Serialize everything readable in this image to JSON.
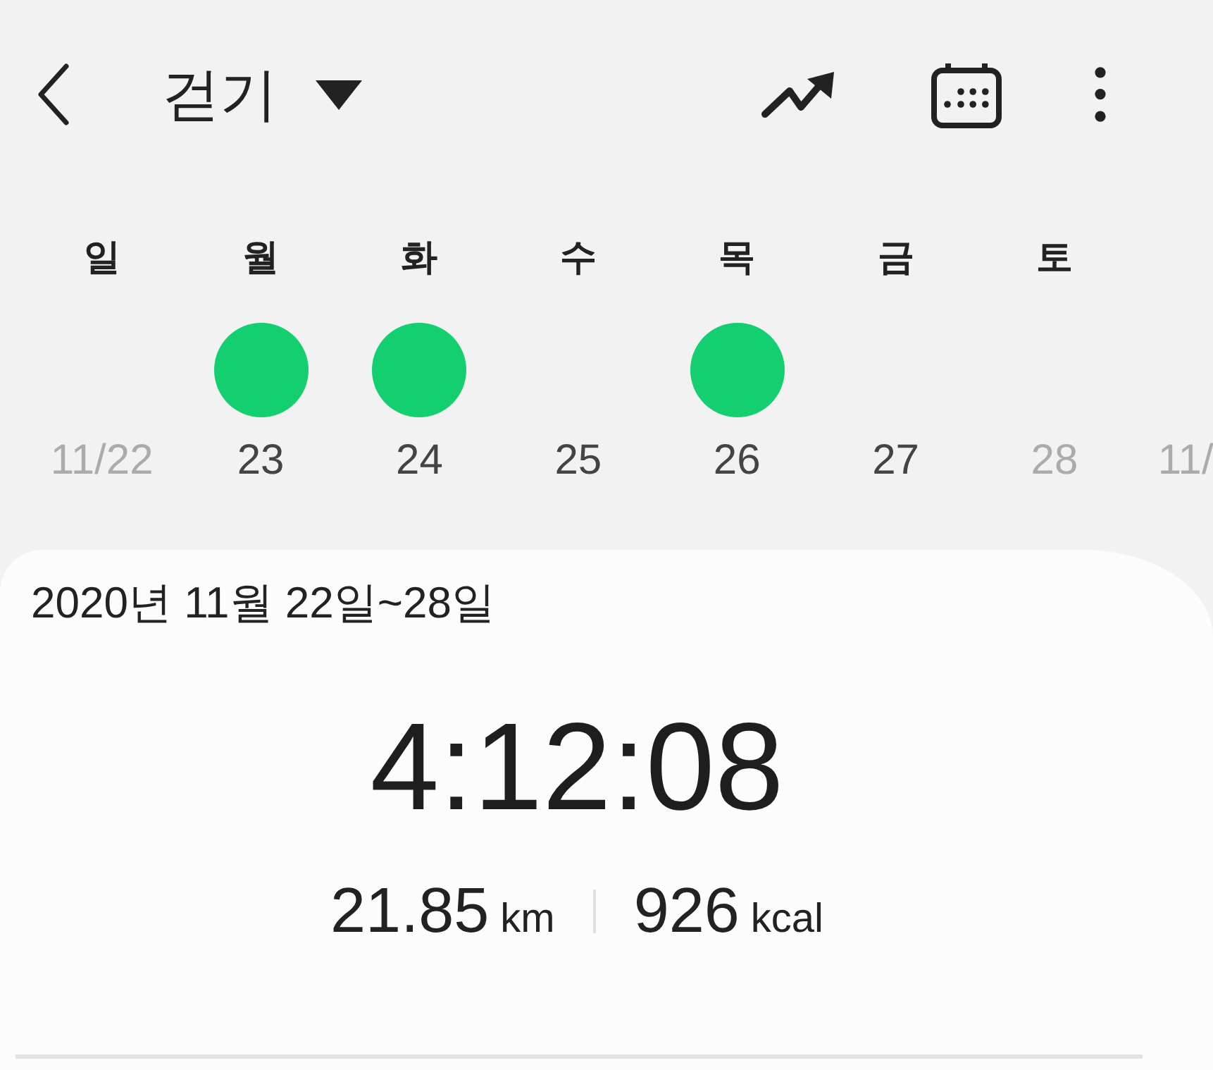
{
  "header": {
    "title": "걷기"
  },
  "week": {
    "weekdays": [
      "일",
      "월",
      "화",
      "수",
      "목",
      "금",
      "토"
    ],
    "days": [
      {
        "date": "11/22",
        "done": false,
        "dimmed": true,
        "cut": false
      },
      {
        "date": "23",
        "done": true,
        "dimmed": false,
        "cut": false
      },
      {
        "date": "24",
        "done": true,
        "dimmed": false,
        "cut": false
      },
      {
        "date": "25",
        "done": false,
        "dimmed": false,
        "cut": false
      },
      {
        "date": "26",
        "done": true,
        "dimmed": false,
        "cut": false
      },
      {
        "date": "27",
        "done": false,
        "dimmed": false,
        "cut": false
      },
      {
        "date": "28",
        "done": false,
        "dimmed": true,
        "cut": false
      },
      {
        "date": "11/",
        "done": false,
        "dimmed": true,
        "cut": true
      }
    ]
  },
  "summary": {
    "range": "2020년 11월 22일~28일",
    "duration": "4:12:08",
    "distance": {
      "value": "21.85",
      "unit": "km"
    },
    "calories": {
      "value": "926",
      "unit": "kcal"
    }
  }
}
